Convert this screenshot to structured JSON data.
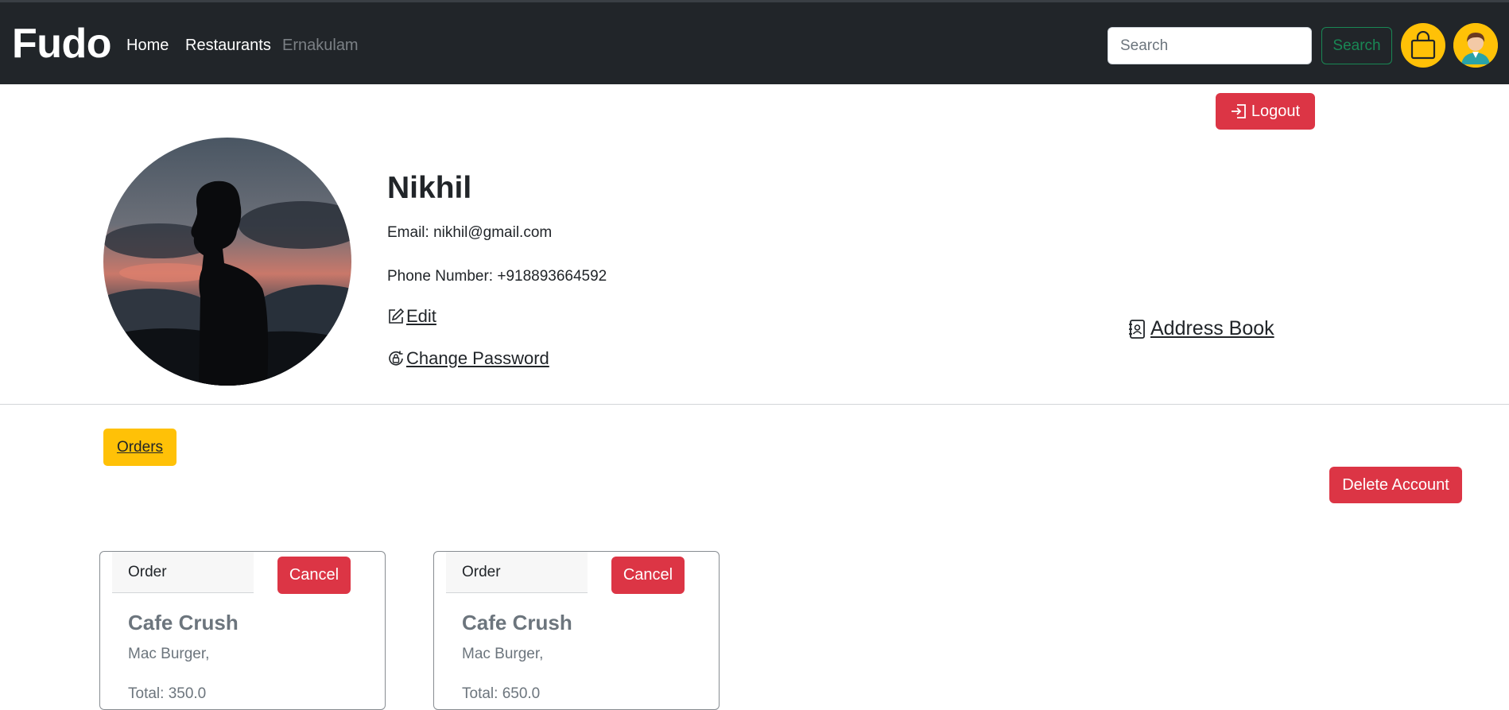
{
  "navbar": {
    "brand": "Fudo",
    "links": [
      {
        "label": "Home"
      },
      {
        "label": "Restaurants"
      },
      {
        "label": "Ernakulam"
      }
    ],
    "search": {
      "placeholder": "Search",
      "button_label": "Search"
    },
    "cart_icon": "shopping-bag-icon",
    "avatar_icon": "user-avatar-icon"
  },
  "logout": {
    "label": "Logout",
    "icon": "logout-icon"
  },
  "profile": {
    "name": "Nikhil",
    "email": "Email: nikhil@gmail.com",
    "phone": "Phone Number: +918893664592",
    "edit_label": "Edit",
    "change_password_label": "Change Password",
    "address_book_label": "Address Book"
  },
  "orders_tab": {
    "label": "Orders"
  },
  "delete_account": {
    "label": "Delete Account"
  },
  "orders": [
    {
      "header": "Order",
      "cancel_label": "Cancel",
      "restaurant": "Cafe Crush",
      "items": "Mac Burger,",
      "total": "Total: 350.0"
    },
    {
      "header": "Order",
      "cancel_label": "Cancel",
      "restaurant": "Cafe Crush",
      "items": "Mac Burger,",
      "total": "Total: 650.0"
    }
  ],
  "colors": {
    "navbar_bg": "#212529",
    "accent_yellow": "#ffc107",
    "danger": "#dc3545",
    "success": "#198754"
  }
}
